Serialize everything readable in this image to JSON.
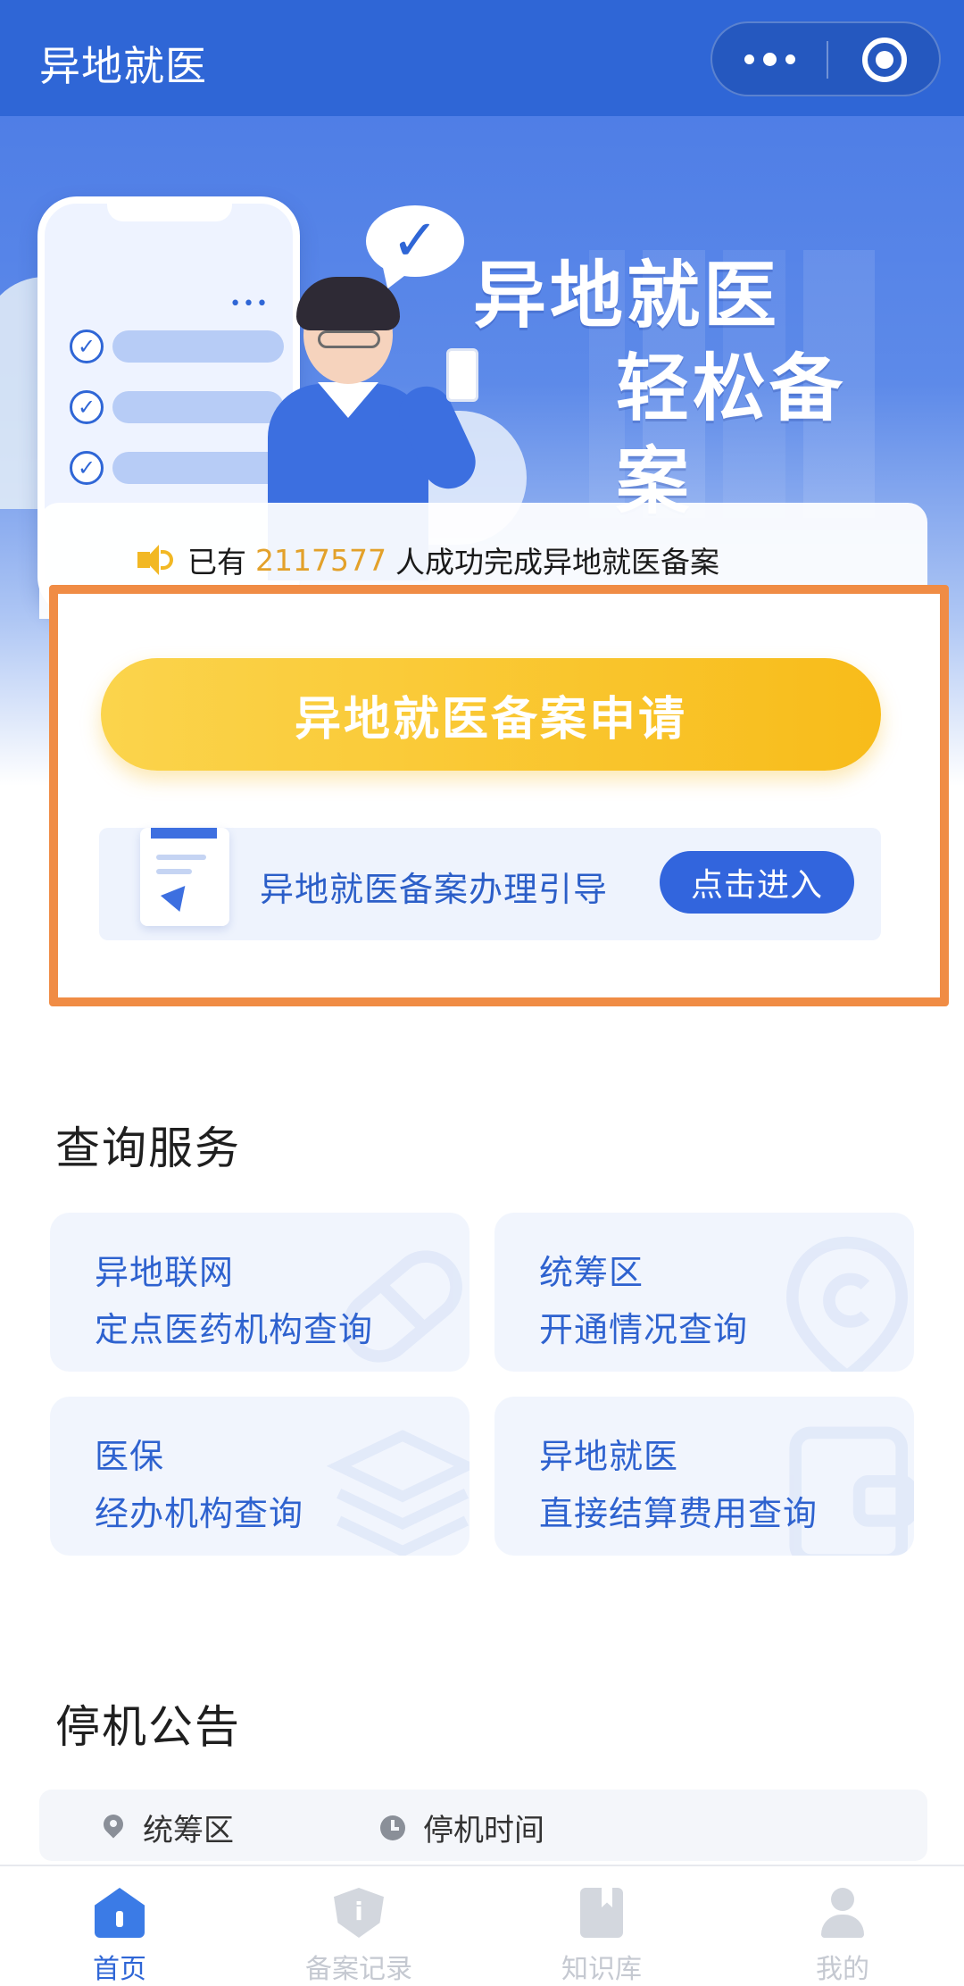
{
  "header": {
    "title": "异地就医",
    "capsule": {
      "more_icon": "more-dots-icon",
      "close_icon": "target-circle-icon"
    }
  },
  "banner": {
    "heading_line1": "异地就医",
    "heading_line2": "轻松备案"
  },
  "notice": {
    "prefix": "已有",
    "count": "2117577",
    "suffix": "人成功完成异地就医备案",
    "icon": "speaker-icon"
  },
  "apply": {
    "label": "异地就医备案申请"
  },
  "guide": {
    "label": "异地就医备案办理引导",
    "button": "点击进入",
    "icon": "document-icon"
  },
  "query_services": {
    "title": "查询服务",
    "items": [
      {
        "line1": "异地联网",
        "line2": "定点医药机构查询",
        "icon": "pill-icon"
      },
      {
        "line1": "统筹区",
        "line2": "开通情况查询",
        "icon": "location-icon"
      },
      {
        "line1": "医保",
        "line2": "经办机构查询",
        "icon": "layers-icon"
      },
      {
        "line1": "异地就医",
        "line2": "直接结算费用查询",
        "icon": "wallet-icon"
      }
    ]
  },
  "shutdown": {
    "title": "停机公告",
    "col_region": "统筹区",
    "col_time": "停机时间"
  },
  "tabbar": {
    "items": [
      {
        "label": "首页",
        "icon": "home-icon",
        "active": true
      },
      {
        "label": "备案记录",
        "icon": "shield-info-icon",
        "active": false
      },
      {
        "label": "知识库",
        "icon": "book-icon",
        "active": false
      },
      {
        "label": "我的",
        "icon": "user-icon",
        "active": false
      }
    ]
  },
  "colors": {
    "primary": "#2f66d6",
    "accent_yellow": "#f8bc1a",
    "highlight_orange": "#f08c45",
    "count_gold": "#e3a12a"
  }
}
